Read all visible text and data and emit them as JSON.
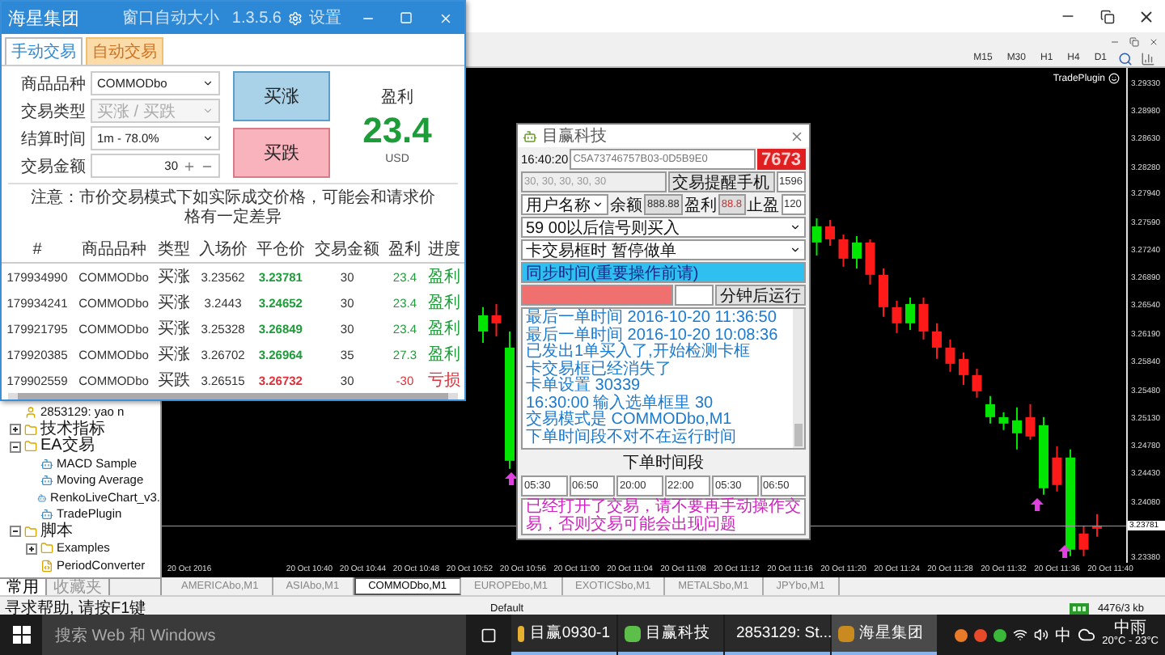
{
  "terminal": {
    "toolbar": {
      "timeframes": [
        "M15",
        "M30",
        "H1",
        "H4",
        "D1"
      ]
    },
    "chart": {
      "indicator_label": "TradePlugin",
      "chart_data": {
        "type": "candlestick",
        "ylim": [
          3.23319,
          3.29533
        ],
        "ref_lines": [
          {
            "axis": "y",
            "value": 3.23781,
            "label": "3.23781"
          }
        ],
        "categories": [
          "20 Oct 2016",
          null,
          null,
          null,
          null,
          null,
          null,
          null,
          null,
          "20 Oct 10:40",
          null,
          null,
          null,
          "20 Oct 10:44",
          null,
          null,
          null,
          "20 Oct 10:48",
          null,
          null,
          null,
          "20 Oct 10:52",
          null,
          null,
          null,
          "20 Oct 10:56",
          null,
          null,
          null,
          "20 Oct 11:00",
          null,
          null,
          null,
          "20 Oct 11:04",
          null,
          null,
          null,
          "20 Oct 11:08",
          null,
          null,
          null,
          "20 Oct 11:12",
          null,
          null,
          null,
          "20 Oct 11:16",
          null,
          null,
          null,
          "20 Oct 11:20",
          null,
          null,
          null,
          "20 Oct 11:24",
          null,
          null,
          null,
          "20 Oct 11:28",
          null,
          null,
          null,
          "20 Oct 11:32",
          null,
          null,
          null,
          "20 Oct 11:36",
          null,
          null,
          null,
          "20 Oct 11:40"
        ],
        "ohlc": [
          null,
          null,
          null,
          null,
          null,
          null,
          null,
          null,
          null,
          null,
          null,
          null,
          null,
          null,
          null,
          null,
          null,
          null,
          null,
          null,
          null,
          null,
          [
            3.26224,
            3.26529,
            3.26082,
            3.26427
          ],
          [
            3.26427,
            3.26569,
            3.26163,
            3.26326
          ],
          [
            3.246,
            3.26224,
            3.24499,
            3.26021
          ],
          null,
          null,
          null,
          null,
          null,
          null,
          null,
          null,
          null,
          null,
          null,
          null,
          null,
          null,
          null,
          null,
          null,
          null,
          null,
          null,
          null,
          null,
          [
            3.27341,
            3.27645,
            3.27178,
            3.27544
          ],
          [
            3.27544,
            3.27625,
            3.273,
            3.27381
          ],
          [
            3.27381,
            3.27442,
            3.27036,
            3.27138
          ],
          [
            3.27138,
            3.27422,
            3.27016,
            3.27341
          ],
          [
            3.27341,
            3.27381,
            3.26813,
            3.26935
          ],
          [
            3.26935,
            3.27016,
            3.26407,
            3.26529
          ],
          [
            3.26529,
            3.2661,
            3.26204,
            3.26326
          ],
          [
            3.26326,
            3.2665,
            3.26244,
            3.26569
          ],
          [
            3.26569,
            3.2665,
            3.26123,
            3.26224
          ],
          [
            3.26224,
            3.26326,
            3.25879,
            3.26021
          ],
          [
            3.26021,
            3.26123,
            3.25717,
            3.25818
          ],
          [
            3.25879,
            3.2596,
            3.25554,
            3.25676
          ],
          [
            3.25676,
            3.25757,
            3.25392,
            3.25473
          ],
          [
            3.25148,
            3.25412,
            3.25067,
            3.25311
          ],
          [
            3.25067,
            3.25209,
            3.24986,
            3.25148
          ],
          [
            3.24945,
            3.2527,
            3.24742,
            3.25108
          ],
          [
            3.25148,
            3.25311,
            3.24864,
            3.24905
          ],
          [
            3.24255,
            3.25148,
            3.24174,
            3.25047
          ],
          [
            3.24641,
            3.24783,
            3.24214,
            3.24296
          ],
          [
            3.23484,
            3.24742,
            3.23402,
            3.24641
          ],
          [
            3.23687,
            3.23788,
            3.23402,
            3.23484
          ],
          [
            3.23788,
            3.2393,
            3.23646,
            3.23747
          ],
          null
        ],
        "yticks": [
          {
            "value": 3.2933,
            "label": "3.29330"
          },
          {
            "value": 3.2898,
            "label": "3.28980"
          },
          {
            "value": 3.2863,
            "label": "3.28630"
          },
          {
            "value": 3.2828,
            "label": "3.28280"
          },
          {
            "value": 3.2794,
            "label": "3.27940"
          },
          {
            "value": 3.2759,
            "label": "3.27590"
          },
          {
            "value": 3.2724,
            "label": "3.27240"
          },
          {
            "value": 3.2689,
            "label": "3.26890"
          },
          {
            "value": 3.2654,
            "label": "3.26540"
          },
          {
            "value": 3.2619,
            "label": "3.26190"
          },
          {
            "value": 3.2584,
            "label": "3.25840"
          },
          {
            "value": 3.2548,
            "label": "3.25480"
          },
          {
            "value": 3.2513,
            "label": "3.25130"
          },
          {
            "value": 3.2478,
            "label": "3.24780"
          },
          {
            "value": 3.2443,
            "label": "3.24430"
          },
          {
            "value": 3.2408,
            "label": "3.24080"
          },
          {
            "value": 3.2338,
            "label": "3.23380"
          }
        ]
      }
    },
    "navigator": {
      "tree": [
        {
          "label": "2853129: yao n",
          "kind": "account"
        },
        {
          "label": "技术指标",
          "kind": "folder",
          "expanded": false
        },
        {
          "label": "EA交易",
          "kind": "folder",
          "expanded": true,
          "children": [
            {
              "label": "MACD Sample",
              "kind": "expert"
            },
            {
              "label": "Moving Average",
              "kind": "expert"
            },
            {
              "label": "RenkoLiveChart_v3.",
              "kind": "expert"
            },
            {
              "label": "TradePlugin",
              "kind": "expert"
            }
          ]
        },
        {
          "label": "脚本",
          "kind": "folder",
          "expanded": true,
          "children": [
            {
              "label": "Examples",
              "kind": "folder",
              "expanded": false
            },
            {
              "label": "PeriodConverter",
              "kind": "script"
            }
          ]
        }
      ],
      "tabs": [
        {
          "label": "常用",
          "selected": true
        },
        {
          "label": "收藏夹",
          "selected": false
        }
      ]
    },
    "chart_tabs": [
      {
        "label": "AMERICAbo,M1",
        "selected": false
      },
      {
        "label": "ASIAbo,M1",
        "selected": false
      },
      {
        "label": "COMMODbo,M1",
        "selected": true
      },
      {
        "label": "EUROPEbo,M1",
        "selected": false
      },
      {
        "label": "EXOTICSbo,M1",
        "selected": false
      },
      {
        "label": "METALSbo,M1",
        "selected": false
      },
      {
        "label": "JPYbo,M1",
        "selected": false
      }
    ],
    "status_bar": {
      "help": "寻求帮助, 请按F1键",
      "profile": "Default",
      "traffic": "4476/3 kb"
    }
  },
  "trade_panel": {
    "title": "海星集团",
    "header_links": [
      "窗口自动大小",
      "1.3.5.6"
    ],
    "settings": "设置",
    "tabs": [
      {
        "label": "手动交易",
        "selected": true
      },
      {
        "label": "自动交易",
        "selected": false
      }
    ],
    "form": [
      {
        "label": "商品品种",
        "value": "COMMODbo",
        "kind": "select",
        "disabled": false
      },
      {
        "label": "交易类型",
        "value": "买涨 / 买跌",
        "kind": "select",
        "disabled": true
      },
      {
        "label": "结算时间",
        "value": "1m - 78.0%",
        "kind": "select",
        "disabled": false
      },
      {
        "label": "交易金额",
        "value": "30",
        "kind": "stepper",
        "disabled": false
      }
    ],
    "buy_up": "买涨",
    "buy_down": "买跌",
    "profit": {
      "label": "盈利",
      "value": "23.4",
      "currency": "USD"
    },
    "note": "注意：市价交易模式下如实际成交价格，可能会和请求价格有一定差异",
    "table": {
      "columns": [
        "#",
        "商品品种",
        "类型",
        "入场价",
        "平仓价",
        "交易金额",
        "盈利",
        "进度"
      ],
      "rows": [
        {
          "kind": "win",
          "cells": [
            "179934990",
            "COMMODbo",
            "买涨",
            "3.23562",
            "3.23781",
            "30",
            "23.4",
            "盈利"
          ]
        },
        {
          "kind": "win",
          "cells": [
            "179934241",
            "COMMODbo",
            "买涨",
            "3.2443",
            "3.24652",
            "30",
            "23.4",
            "盈利"
          ]
        },
        {
          "kind": "win",
          "cells": [
            "179921795",
            "COMMODbo",
            "买涨",
            "3.25328",
            "3.26849",
            "30",
            "23.4",
            "盈利"
          ]
        },
        {
          "kind": "win",
          "cells": [
            "179920385",
            "COMMODbo",
            "买涨",
            "3.26702",
            "3.26964",
            "35",
            "27.3",
            "盈利"
          ]
        },
        {
          "kind": "loss",
          "cells": [
            "179902559",
            "COMMODbo",
            "买跌",
            "3.26515",
            "3.26732",
            "30",
            "-30",
            "亏损"
          ]
        }
      ]
    }
  },
  "robot": {
    "title": "目赢科技",
    "time": "16:40:20",
    "code": "C5A73746757B03-0D5B9E0",
    "counter": "7673",
    "schedule": "30, 30, 30, 30, 30",
    "phone_button": "交易提醒手机",
    "phone": "1596",
    "account": "用户名称",
    "balance_label": "余额",
    "balance": "888.88",
    "profit_label": "盈利",
    "profit": "88.8",
    "takeprofit_label": "止盈",
    "takeprofit": "120",
    "signal_mode": "59 00以后信号则买入",
    "stuck_mode": "卡交易框时 暂停做单",
    "sync_button": "同步时间(重要操作前请)",
    "run_after": "分钟后运行",
    "log": [
      "最后一单时间 2016-10-20 11:36:50",
      "最后一单时间 2016-10-20 10:08:36",
      "已发出1单买入了,开始检测卡框",
      "卡交易框已经消失了",
      "卡单设置 30339",
      "16:30:00 输入选单框里 30",
      "交易模式是 COMMODbo,M1",
      "下单时间段不对不在运行时间"
    ],
    "period_label": "下单时间段",
    "periods": [
      "05:30",
      "06:50",
      "20:00",
      "22:00",
      "05:30",
      "06:50"
    ],
    "warning": "已经打开了交易，请不要再手动操作交易，否则交易可能会出现问题"
  },
  "taskbar": {
    "search_placeholder": "搜索 Web 和 Windows",
    "apps": [
      {
        "label": "目赢0930-1",
        "selected": false
      },
      {
        "label": "目赢科技",
        "selected": false
      },
      {
        "label": "2853129: St...",
        "selected": false
      },
      {
        "label": "海星集团",
        "selected": true
      }
    ],
    "ime": "中",
    "weather": "中雨",
    "temperature": "20°C - 23°C"
  }
}
